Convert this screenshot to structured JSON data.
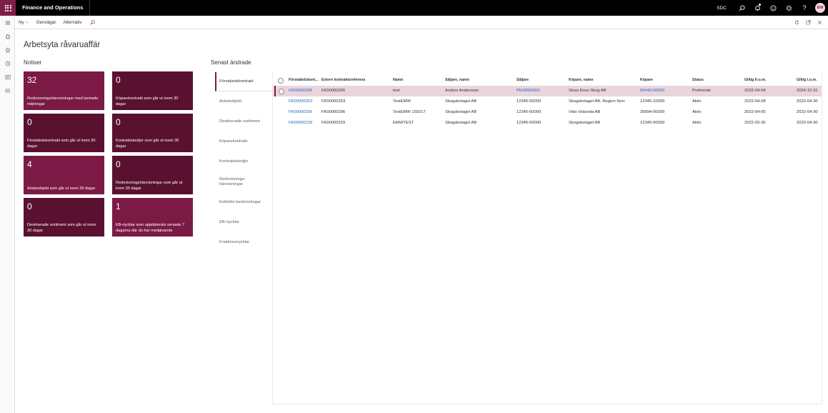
{
  "app": {
    "title": "Finance and Operations",
    "company": "SDC",
    "avatar_initials": "EW",
    "accent": "#7e1e46"
  },
  "actionpane": {
    "new_label": "Ny",
    "shortcuts_label": "Genvägar",
    "options_label": "Alternativ"
  },
  "page": {
    "title": "Arbetsyta råvaruaffär",
    "notices_heading": "Notiser",
    "recent_heading": "Senast ändrade"
  },
  "tiles": [
    {
      "count": "32",
      "label": "Redovisningshänvisningar med larmade mätningar",
      "color": "#7b1a45"
    },
    {
      "count": "0",
      "label": "Köparekontrakt som går ut inom 30 dagar",
      "color": "#5a1130"
    },
    {
      "count": "0",
      "label": "Förstaledskontrakt som går ut inom 30 dagar",
      "color": "#5a1130"
    },
    {
      "count": "0",
      "label": "Kontraktskedjor som går ut inom 30 dagar",
      "color": "#5a1130"
    },
    {
      "count": "4",
      "label": "Avtalsobjekt som går ut inom 30 dagar",
      "color": "#7b1a45"
    },
    {
      "count": "0",
      "label": "Redovisningshänvisningar som går ut inom 30 dagar",
      "color": "#5a1130"
    },
    {
      "count": "0",
      "label": "Destinerade sortiment som går ut inom 30 dagar",
      "color": "#5a1130"
    },
    {
      "count": "1",
      "label": "EB-nycklar som uppdaterats senaste 7 dagarna där du har medgivande",
      "color": "#7b1a45"
    }
  ],
  "vtabs": [
    {
      "label": "Förstaledskontrakt",
      "active": true
    },
    {
      "label": "Avtalsobjekt"
    },
    {
      "label": "Destinerade sortiment"
    },
    {
      "label": "Köparekontrakt"
    },
    {
      "label": "Kontraktskedjor"
    },
    {
      "label": "Redovisnings-\nhänvisningar"
    },
    {
      "label": "Kollektiv-beskrivningar"
    },
    {
      "label": "EB-nycklar"
    },
    {
      "label": "Fraktionsnycklar"
    }
  ],
  "grid": {
    "columns": [
      "Förstaledskont...",
      "Extern kontraktsreferens",
      "Namn",
      "Säljare, namn",
      "Säljare",
      "Köpare, namn",
      "Köpare",
      "Status",
      "Giltig fr.o.m.",
      "Giltig t.o.m."
    ],
    "rows": [
      [
        "FK00000285",
        "FK00000285",
        "test",
        "Anders Andersson",
        "PE00000001",
        "Stora Enso Skog AB",
        "06440-00000",
        "Preliminär",
        "2022-04-04",
        "2024-12-31"
      ],
      [
        "FK00000353",
        "FK00000353",
        "TestEMW",
        "Skogsbolaget AB",
        "12345-00000",
        "Skogsbolaget AB, Region Norr",
        "12345-10000",
        "Aktiv",
        "2022-04-08",
        "2022-04-30"
      ],
      [
        "FK00000296",
        "FK00000296",
        "TestEMW 159217",
        "Skogsbolaget AB",
        "12345-00000",
        "Vida Vislanda AB",
        "39594-00000",
        "Aktiv",
        "2022-04-05",
        "2022-04-30"
      ],
      [
        "FK00000229",
        "FK00000229",
        "EMWTEST",
        "Skogsbolaget AB",
        "12345-00000",
        "Skogsbolaget AB",
        "12345-00000",
        "Aktiv",
        "2022-03-30",
        "2022-04-30"
      ]
    ]
  }
}
